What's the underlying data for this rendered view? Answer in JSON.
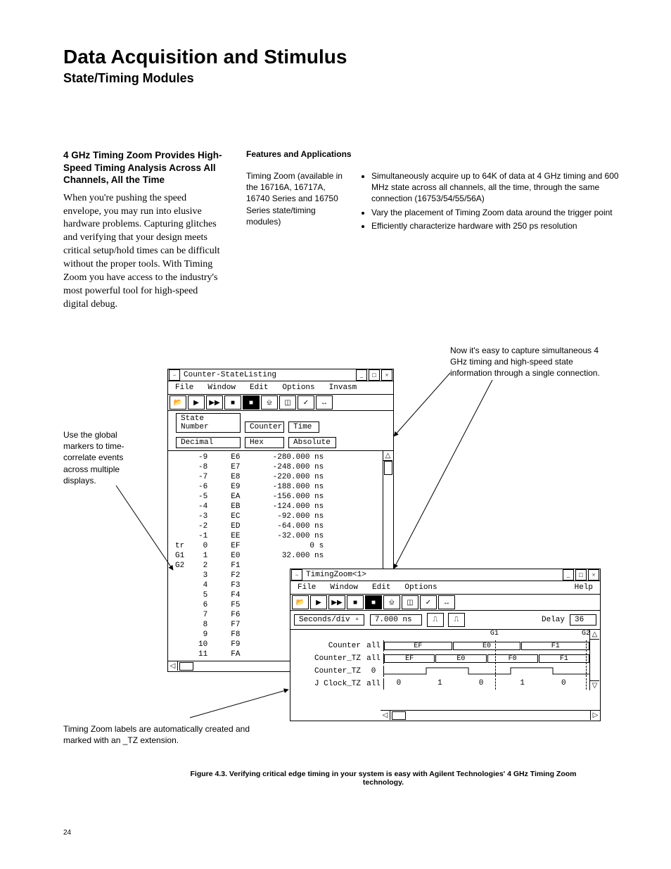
{
  "page": {
    "title": "Data Acquisition and Stimulus",
    "subtitle": "State/Timing Modules",
    "number": "24"
  },
  "intro": {
    "heading": "4 GHz Timing Zoom Provides High-Speed Timing Analysis Across All Channels, All the Time",
    "body": "When you're pushing the speed envelope, you may run into elusive hardware problems. Capturing glitches and verifying that your design meets critical setup/hold times can be difficult without the proper tools. With Timing Zoom you have access to the industry's most powerful tool for high-speed digital debug."
  },
  "features": {
    "heading": "Features and Applications",
    "label": "Timing Zoom (available in the 16716A, 16717A, 16740 Series and 16750 Series state/timing modules)",
    "bullets": [
      "Simultaneously acquire up to 64K of data at 4 GHz timing and 600 MHz state across all channels, all the time, through the same connection (16753/54/55/56A)",
      "Vary the placement of Timing Zoom data around the trigger point",
      "Efficiently characterize hardware with 250 ps resolution"
    ]
  },
  "callouts": {
    "right": "Now it's easy to capture simultaneous 4 GHz timing and high-speed state information through a single connection.",
    "left": "Use the global markers to time-correlate events across multiple displays.",
    "bottom": "Timing Zoom labels are automatically created and marked with an _TZ extension."
  },
  "figure_caption": "Figure 4.3. Verifying critical edge timing in your system is easy with Agilent Technologies' 4 GHz Timing Zoom technology.",
  "win1": {
    "title": "Counter-StateListing",
    "menus": [
      "File",
      "Window",
      "Edit",
      "Options",
      "Invasm"
    ],
    "columns": {
      "c1": "State Number",
      "c2": "Counter",
      "c3": "Time"
    },
    "formats": {
      "c1": "Decimal",
      "c2": "Hex",
      "c3": "Absolute"
    },
    "rows": [
      {
        "s": "-9",
        "c": "E6",
        "t": "-280.000 ns"
      },
      {
        "s": "-8",
        "c": "E7",
        "t": "-248.000 ns"
      },
      {
        "s": "-7",
        "c": "E8",
        "t": "-220.000 ns"
      },
      {
        "s": "-6",
        "c": "E9",
        "t": "-188.000 ns"
      },
      {
        "s": "-5",
        "c": "EA",
        "t": "-156.000 ns"
      },
      {
        "s": "-4",
        "c": "EB",
        "t": "-124.000 ns"
      },
      {
        "s": "-3",
        "c": "EC",
        "t": "-92.000 ns"
      },
      {
        "s": "-2",
        "c": "ED",
        "t": "-64.000 ns"
      },
      {
        "s": "-1",
        "c": "EE",
        "t": "-32.000 ns"
      },
      {
        "s": "0",
        "c": "EF",
        "t": "0 s",
        "mark": "tr"
      },
      {
        "s": "1",
        "c": "E0",
        "t": "32.000 ns",
        "mark": "G1"
      },
      {
        "s": "2",
        "c": "F1",
        "t": "",
        "mark": "G2"
      },
      {
        "s": "3",
        "c": "F2",
        "t": ""
      },
      {
        "s": "4",
        "c": "F3",
        "t": ""
      },
      {
        "s": "5",
        "c": "F4",
        "t": ""
      },
      {
        "s": "6",
        "c": "F5",
        "t": ""
      },
      {
        "s": "7",
        "c": "F6",
        "t": ""
      },
      {
        "s": "8",
        "c": "F7",
        "t": ""
      },
      {
        "s": "9",
        "c": "F8",
        "t": ""
      },
      {
        "s": "10",
        "c": "F9",
        "t": ""
      },
      {
        "s": "11",
        "c": "FA",
        "t": ""
      }
    ]
  },
  "win2": {
    "title": "TimingZoom<1>",
    "menus": [
      "File",
      "Window",
      "Edit",
      "Options"
    ],
    "help": "Help",
    "timebase_label": "Seconds/div",
    "timebase_value": "7.000 ns",
    "delay_label": "Delay",
    "delay_value": "36",
    "markers": {
      "g1": "G1",
      "g2": "G2"
    },
    "signals": [
      {
        "name": "Counter",
        "fmt": "all",
        "bus": [
          "EF",
          "E0",
          "F1"
        ]
      },
      {
        "name": "Counter_TZ",
        "fmt": "all",
        "bus": [
          "EF",
          "E0",
          "F0",
          "F1"
        ]
      },
      {
        "name": "Counter_TZ",
        "fmt": "0",
        "wave": "pulse"
      },
      {
        "name": "J Clock_TZ",
        "fmt": "all",
        "digits": [
          "0",
          "1",
          "0",
          "1",
          "0"
        ]
      }
    ]
  }
}
